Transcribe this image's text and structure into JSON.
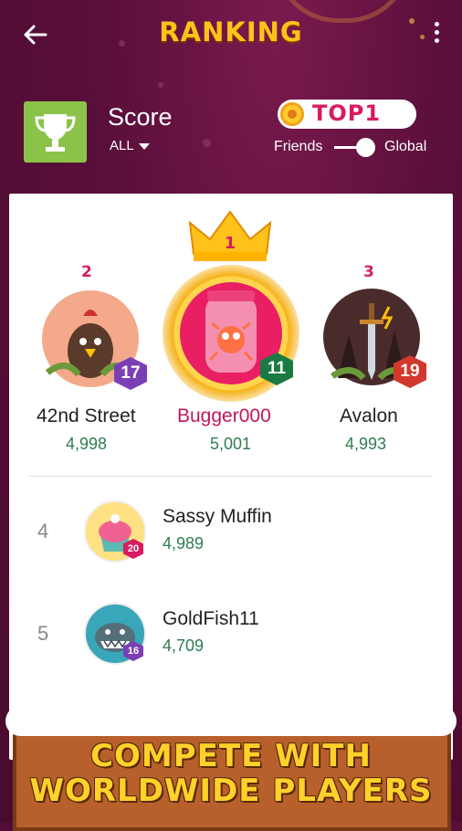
{
  "header": {
    "title": "RANKING"
  },
  "score_section": {
    "label": "Score",
    "filter": "ALL"
  },
  "top_badge": {
    "label": "TOP1"
  },
  "scope_toggle": {
    "left": "Friends",
    "right": "Global",
    "selected": "Global"
  },
  "podium": [
    {
      "rank": "2",
      "name": "42nd Street",
      "score": "4,998",
      "level": "17",
      "level_color": "#7b3fb5",
      "avatar": "rooster-icon"
    },
    {
      "rank": "1",
      "name": "Bugger000",
      "score": "5,001",
      "level": "11",
      "level_color": "#1b7a43",
      "avatar": "bug-jar-icon"
    },
    {
      "rank": "3",
      "name": "Avalon",
      "score": "4,993",
      "level": "19",
      "level_color": "#d0392b",
      "avatar": "sword-icon"
    }
  ],
  "list": [
    {
      "rank": "4",
      "name": "Sassy Muffin",
      "score": "4,989",
      "level": "20",
      "level_color": "#d81b60",
      "avatar": "muffin-icon"
    },
    {
      "rank": "5",
      "name": "GoldFish11",
      "score": "4,709",
      "level": "16",
      "level_color": "#7b3fb5",
      "avatar": "shark-icon"
    }
  ],
  "banner": {
    "line1": "COMPETE WITH",
    "line2": "WORLDWIDE PLAYERS"
  }
}
